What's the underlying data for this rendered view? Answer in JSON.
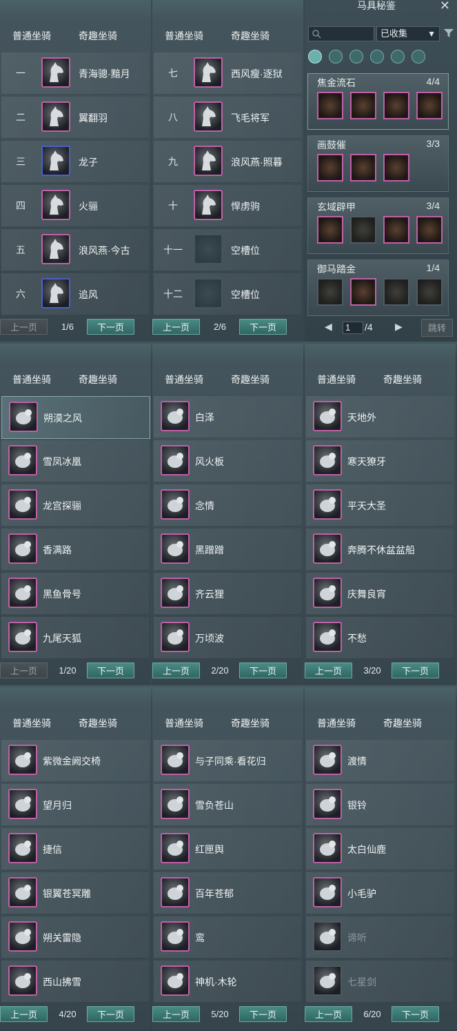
{
  "tabs": {
    "normal": "普通坐骑",
    "fun": "奇趣坐骑"
  },
  "buttons": {
    "prev": "上一页",
    "next": "下一页"
  },
  "panels": [
    {
      "page": "1/6",
      "prev_disabled": true,
      "rows": [
        {
          "rank": "一",
          "name": "青海骢·黯月",
          "frame": "pink"
        },
        {
          "rank": "二",
          "name": "翼翻羽",
          "frame": "pink"
        },
        {
          "rank": "三",
          "name": "龙子",
          "frame": "blue"
        },
        {
          "rank": "四",
          "name": "火骊",
          "frame": "pink"
        },
        {
          "rank": "五",
          "name": "浪风燕·今古",
          "frame": "pink"
        },
        {
          "rank": "六",
          "name": "追风",
          "frame": "blue"
        }
      ]
    },
    {
      "page": "2/6",
      "prev_disabled": false,
      "rows": [
        {
          "rank": "七",
          "name": "西风瘦·逐狱",
          "frame": "pink"
        },
        {
          "rank": "八",
          "name": "飞毛将军",
          "frame": "pink"
        },
        {
          "rank": "九",
          "name": "浪风燕·照暮",
          "frame": "pink"
        },
        {
          "rank": "十",
          "name": "悍虏驹",
          "frame": "pink"
        },
        {
          "rank": "十一",
          "name": "空槽位",
          "frame": "empty"
        },
        {
          "rank": "十二",
          "name": "空槽位",
          "frame": "empty"
        }
      ]
    },
    {
      "page": "1/20",
      "prev_disabled": true,
      "rows": [
        {
          "name": "朔漠之风",
          "frame": "pink",
          "selected": true
        },
        {
          "name": "雪凤冰凰",
          "frame": "pink"
        },
        {
          "name": "龙宫探骊",
          "frame": "pink"
        },
        {
          "name": "香满路",
          "frame": "pink"
        },
        {
          "name": "黑鱼骨号",
          "frame": "pink"
        },
        {
          "name": "九尾天狐",
          "frame": "pink"
        }
      ]
    },
    {
      "page": "2/20",
      "prev_disabled": false,
      "rows": [
        {
          "name": "白泽",
          "frame": "pink"
        },
        {
          "name": "风火板",
          "frame": "pink"
        },
        {
          "name": "念情",
          "frame": "pink"
        },
        {
          "name": "黑蹭蹭",
          "frame": "pink"
        },
        {
          "name": "齐云狸",
          "frame": "pink"
        },
        {
          "name": "万顷波",
          "frame": "pink"
        }
      ]
    },
    {
      "page": "3/20",
      "prev_disabled": false,
      "rows": [
        {
          "name": "天地外",
          "frame": "pink"
        },
        {
          "name": "寒天獠牙",
          "frame": "pink"
        },
        {
          "name": "平天大圣",
          "frame": "pink"
        },
        {
          "name": "奔腾不休盆盆船",
          "frame": "pink"
        },
        {
          "name": "庆舞良宵",
          "frame": "pink"
        },
        {
          "name": "不愁",
          "frame": "pink"
        }
      ]
    },
    {
      "page": "4/20",
      "prev_disabled": false,
      "rows": [
        {
          "name": "紫微金阙交椅",
          "frame": "pink"
        },
        {
          "name": "望月归",
          "frame": "pink"
        },
        {
          "name": "捷信",
          "frame": "pink"
        },
        {
          "name": "银翼苍冥雕",
          "frame": "pink"
        },
        {
          "name": "朔关雷隐",
          "frame": "pink"
        },
        {
          "name": "西山拂雪",
          "frame": "pink"
        }
      ]
    },
    {
      "page": "5/20",
      "prev_disabled": false,
      "rows": [
        {
          "name": "与子同乘·看花归",
          "frame": "pink"
        },
        {
          "name": "雪负苍山",
          "frame": "pink"
        },
        {
          "name": "红匣舆",
          "frame": "pink"
        },
        {
          "name": "百年苍郁",
          "frame": "pink"
        },
        {
          "name": "鸾",
          "frame": "pink"
        },
        {
          "name": "神机·木轮",
          "frame": "pink"
        }
      ]
    },
    {
      "page": "6/20",
      "prev_disabled": false,
      "rows": [
        {
          "name": "渡情",
          "frame": "pink"
        },
        {
          "name": "银铃",
          "frame": "pink"
        },
        {
          "name": "太白仙鹿",
          "frame": "pink"
        },
        {
          "name": "小毛驴",
          "frame": "pink"
        },
        {
          "name": "谛听",
          "frame": "grey",
          "dim": true
        },
        {
          "name": "七星剑",
          "frame": "grey",
          "dim": true
        }
      ]
    }
  ],
  "codex": {
    "title": "马具秘鉴",
    "filter_value": "已收集",
    "sets": [
      {
        "name": "焦金流石",
        "count": "4/4",
        "owned": [
          true,
          true,
          true,
          true
        ]
      },
      {
        "name": "画鼓催",
        "count": "3/3",
        "owned": [
          true,
          true,
          true
        ]
      },
      {
        "name": "玄域辟甲",
        "count": "3/4",
        "owned": [
          true,
          false,
          true,
          true
        ]
      },
      {
        "name": "御马踏金",
        "count": "1/4",
        "owned": [
          false,
          true,
          false,
          false
        ]
      }
    ],
    "page_input": "1",
    "page_total": "/4",
    "jump_label": "跳转"
  }
}
